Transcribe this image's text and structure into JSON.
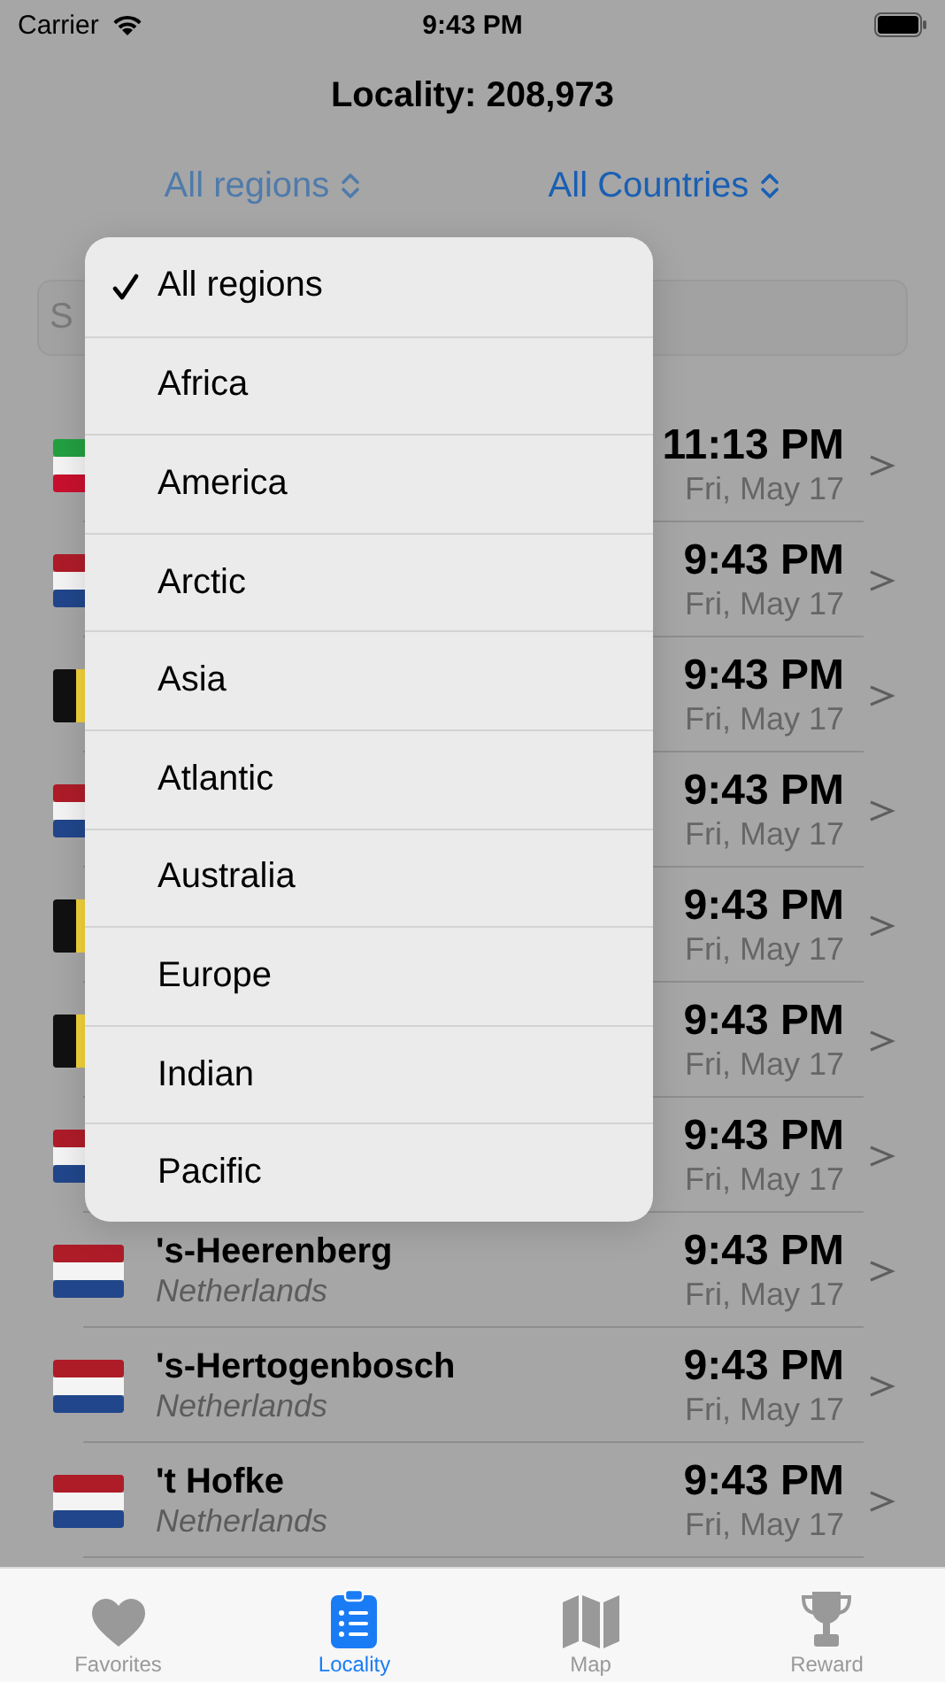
{
  "status_bar": {
    "carrier": "Carrier",
    "time": "9:43 PM"
  },
  "title": "Locality: 208,973",
  "filters": [
    {
      "label": "All regions",
      "active": false
    },
    {
      "label": "All Countries",
      "active": true
    }
  ],
  "search": {
    "placeholder": "S"
  },
  "rows": [
    {
      "kind": "iran",
      "time": "11:13 PM",
      "date": "Fri, May 17"
    },
    {
      "kind": "netherlands",
      "time": "9:43 PM",
      "date": "Fri, May 17"
    },
    {
      "kind": "belgium",
      "time": "9:43 PM",
      "date": "Fri, May 17"
    },
    {
      "kind": "netherlands",
      "time": "9:43 PM",
      "date": "Fri, May 17"
    },
    {
      "kind": "belgium",
      "time": "9:43 PM",
      "date": "Fri, May 17"
    },
    {
      "kind": "belgium",
      "time": "9:43 PM",
      "date": "Fri, May 17"
    },
    {
      "kind": "netherlands",
      "time": "9:43 PM",
      "date": "Fri, May 17"
    },
    {
      "kind": "netherlands",
      "name": "'s-Heerenberg",
      "country": "Netherlands",
      "time": "9:43 PM",
      "date": "Fri, May 17"
    },
    {
      "kind": "netherlands",
      "name": "'s-Hertogenbosch",
      "country": "Netherlands",
      "time": "9:43 PM",
      "date": "Fri, May 17"
    },
    {
      "kind": "netherlands",
      "name": "'t Hofke",
      "country": "Netherlands",
      "time": "9:43 PM",
      "date": "Fri, May 17"
    }
  ],
  "region_menu": [
    {
      "label": "All regions",
      "selected": true
    },
    {
      "label": "Africa",
      "selected": false
    },
    {
      "label": "America",
      "selected": false
    },
    {
      "label": "Arctic",
      "selected": false
    },
    {
      "label": "Asia",
      "selected": false
    },
    {
      "label": "Atlantic",
      "selected": false
    },
    {
      "label": "Australia",
      "selected": false
    },
    {
      "label": "Europe",
      "selected": false
    },
    {
      "label": "Indian",
      "selected": false
    },
    {
      "label": "Pacific",
      "selected": false
    }
  ],
  "tabs": [
    {
      "label": "Favorites",
      "selected": false
    },
    {
      "label": "Locality",
      "selected": true
    },
    {
      "label": "Map",
      "selected": false
    },
    {
      "label": "Reward",
      "selected": false
    }
  ]
}
